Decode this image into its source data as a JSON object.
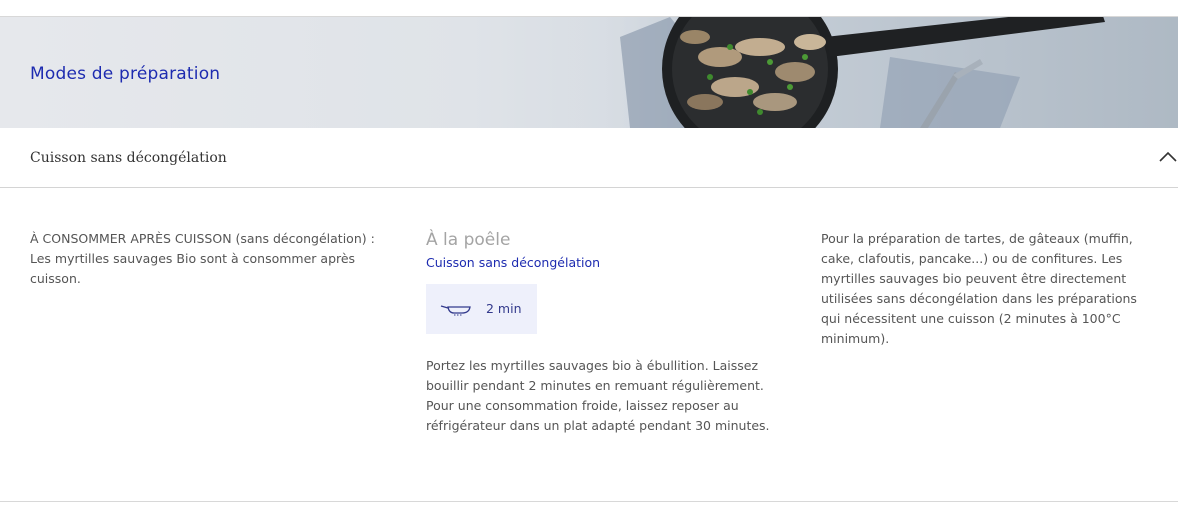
{
  "banner": {
    "title": "Modes de préparation",
    "photo": "sauteed-mushrooms-pan-photo"
  },
  "accordion": {
    "label": "Cuisson sans décongélation",
    "expanded": true,
    "toggle_icon": "chevron-up-icon"
  },
  "intro": {
    "text": "À CONSOMMER APRÈS CUISSON (sans décongélation) : Les myrtilles sauvages Bio sont à consommer après cuisson."
  },
  "method": {
    "title": "À la poêle",
    "subtitle": "Cuisson sans décongélation",
    "time_icon": "frying-pan-icon",
    "time": "2 min",
    "description": "Portez les myrtilles sauvages bio à ébullition. Laissez bouillir pendant 2 minutes en remuant régulièrement. Pour une consommation froide, laissez reposer au réfrigérateur dans un plat adapté pendant 30 minutes."
  },
  "note": {
    "text": "Pour la préparation de tartes, de gâteaux (muffin, cake, clafoutis, pancake...) ou de confitures. Les myrtilles sauvages bio peuvent être directement utilisées sans décongélation dans les préparations qui nécessitent une cuisson (2 minutes à 100°C minimum)."
  },
  "colors": {
    "accent": "#1d2bb0",
    "muted_title": "#a4a4a4",
    "time_box_bg": "#eef0fb"
  }
}
